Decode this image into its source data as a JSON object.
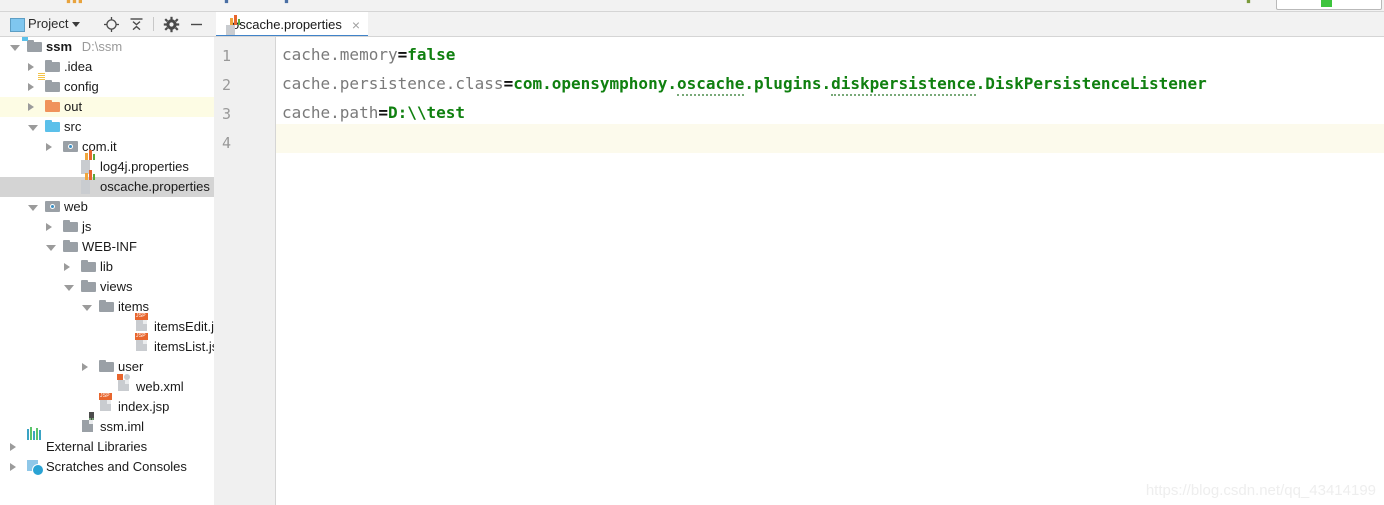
{
  "window": {
    "top_strip_fragments": [
      "▮▮▮",
      "▮▮",
      "▮▮"
    ],
    "top_right_indicator": "green-run-indicator"
  },
  "project_panel": {
    "toolbar": {
      "title": "Project",
      "dropdown_caret": "chevron-down-icon",
      "buttons": [
        {
          "name": "locate-icon",
          "label": "⊕"
        },
        {
          "name": "collapse-all-icon",
          "label": "⥮"
        },
        {
          "name": "settings-gear-icon",
          "label": "✷"
        },
        {
          "name": "hide-panel-icon",
          "label": "—"
        }
      ]
    },
    "tree": [
      {
        "label": "ssm",
        "path": "D:\\ssm",
        "indent": 0,
        "arrow": "open",
        "icon": "module-folder",
        "bold": true,
        "state": "normal"
      },
      {
        "label": ".idea",
        "path": "",
        "indent": 1,
        "arrow": "closed",
        "icon": "folder-gray",
        "bold": false,
        "state": "normal"
      },
      {
        "label": "config",
        "path": "",
        "indent": 1,
        "arrow": "closed",
        "icon": "folder-resources",
        "bold": false,
        "state": "normal"
      },
      {
        "label": "out",
        "path": "",
        "indent": 1,
        "arrow": "closed",
        "icon": "folder-orange",
        "bold": false,
        "state": "highlight"
      },
      {
        "label": "src",
        "path": "",
        "indent": 1,
        "arrow": "open",
        "icon": "folder-blue",
        "bold": false,
        "state": "normal"
      },
      {
        "label": "com.it",
        "path": "",
        "indent": 2,
        "arrow": "closed",
        "icon": "package-folder",
        "bold": false,
        "state": "normal"
      },
      {
        "label": "log4j.properties",
        "path": "",
        "indent": 3,
        "arrow": "none",
        "icon": "properties-file",
        "bold": false,
        "state": "normal"
      },
      {
        "label": "oscache.properties",
        "path": "",
        "indent": 3,
        "arrow": "none",
        "icon": "properties-file",
        "bold": false,
        "state": "selected"
      },
      {
        "label": "web",
        "path": "",
        "indent": 1,
        "arrow": "open",
        "icon": "package-folder",
        "bold": false,
        "state": "normal"
      },
      {
        "label": "js",
        "path": "",
        "indent": 2,
        "arrow": "closed",
        "icon": "folder-gray",
        "bold": false,
        "state": "normal"
      },
      {
        "label": "WEB-INF",
        "path": "",
        "indent": 2,
        "arrow": "open",
        "icon": "folder-gray",
        "bold": false,
        "state": "normal"
      },
      {
        "label": "lib",
        "path": "",
        "indent": 3,
        "arrow": "closed",
        "icon": "folder-gray",
        "bold": false,
        "state": "normal"
      },
      {
        "label": "views",
        "path": "",
        "indent": 3,
        "arrow": "open",
        "icon": "folder-gray",
        "bold": false,
        "state": "normal"
      },
      {
        "label": "items",
        "path": "",
        "indent": 4,
        "arrow": "open",
        "icon": "folder-gray",
        "bold": false,
        "state": "normal"
      },
      {
        "label": "itemsEdit.jsp",
        "path": "",
        "indent": 6,
        "arrow": "none",
        "icon": "jsp-file",
        "bold": false,
        "state": "normal"
      },
      {
        "label": "itemsList.jsp",
        "path": "",
        "indent": 6,
        "arrow": "none",
        "icon": "jsp-file",
        "bold": false,
        "state": "normal"
      },
      {
        "label": "user",
        "path": "",
        "indent": 4,
        "arrow": "closed",
        "icon": "folder-gray",
        "bold": false,
        "state": "normal"
      },
      {
        "label": "web.xml",
        "path": "",
        "indent": 5,
        "arrow": "none",
        "icon": "xml-file",
        "bold": false,
        "state": "normal"
      },
      {
        "label": "index.jsp",
        "path": "",
        "indent": 4,
        "arrow": "none",
        "icon": "jsp-file",
        "bold": false,
        "state": "normal"
      },
      {
        "label": "ssm.iml",
        "path": "",
        "indent": 3,
        "arrow": "none",
        "icon": "iml-file",
        "bold": false,
        "state": "normal"
      },
      {
        "label": "External Libraries",
        "path": "",
        "indent": 0,
        "arrow": "closed",
        "icon": "libraries",
        "bold": false,
        "state": "normal"
      },
      {
        "label": "Scratches and Consoles",
        "path": "",
        "indent": 0,
        "arrow": "closed",
        "icon": "scratches",
        "bold": false,
        "state": "normal"
      }
    ]
  },
  "editor": {
    "tabs": [
      {
        "label": "oscache.properties",
        "icon": "properties-file",
        "close": "×",
        "active": true
      }
    ],
    "active_tab_accent": "#4083c9",
    "caret_line": 4,
    "lines": [
      {
        "num": "1",
        "key": "cache.memory",
        "eq": "=",
        "value": "false",
        "spell_spans": []
      },
      {
        "num": "2",
        "key": "cache.persistence.class",
        "eq": "=",
        "value": "com.opensymphony.oscache.plugins.diskpersistence.DiskPersistenceListener",
        "spell_spans": [
          "oscache",
          "diskpersistence"
        ]
      },
      {
        "num": "3",
        "key": "cache.path",
        "eq": "=",
        "value": "D:\\\\test",
        "spell_spans": []
      },
      {
        "num": "4",
        "key": "",
        "eq": "",
        "value": "",
        "spell_spans": []
      }
    ]
  },
  "watermark": {
    "text": "https://blog.csdn.net/qq_43414199"
  },
  "colors": {
    "accent_blue": "#4083c9",
    "value_green": "#108010",
    "selection_gray": "#d4d4d4",
    "highlight_yellow": "#fdfce4",
    "caret_line": "#fcfaec"
  }
}
